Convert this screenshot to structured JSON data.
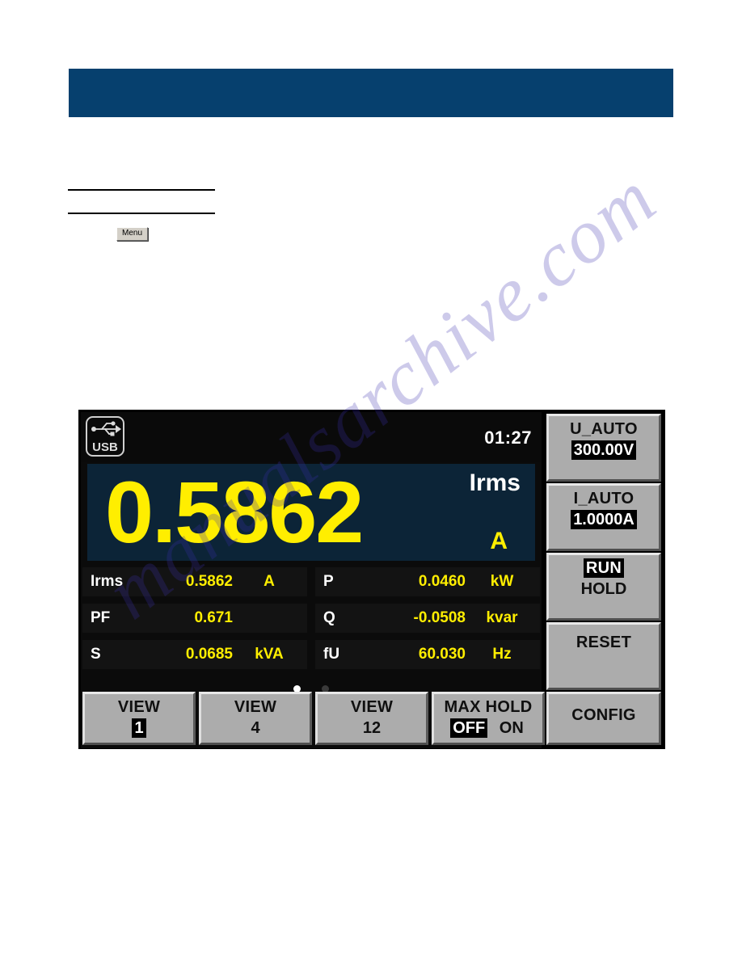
{
  "watermark": {
    "text": "manualsarchive.com"
  },
  "document": {
    "menu_button_label": "Menu"
  },
  "device": {
    "status_bar": {
      "usb_icon_label": "USB",
      "clock": "01:27"
    },
    "primary_reading": {
      "value": "0.5862",
      "quantity": "Irms",
      "unit": "A"
    },
    "measurements": {
      "left": [
        {
          "label": "Irms",
          "value": "0.5862",
          "unit": "A"
        },
        {
          "label": "PF",
          "value": "0.671",
          "unit": ""
        },
        {
          "label": "S",
          "value": "0.0685",
          "unit": "kVA"
        }
      ],
      "right": [
        {
          "label": "P",
          "value": "0.0460",
          "unit": "kW"
        },
        {
          "label": "Q",
          "value": "-0.0508",
          "unit": "kvar"
        },
        {
          "label": "fU",
          "value": "60.030",
          "unit": "Hz"
        }
      ]
    },
    "page_indicator": {
      "pages": 2,
      "active": 1
    },
    "side_keys": {
      "u_auto": {
        "title": "U_AUTO",
        "value": "300.00V"
      },
      "i_auto": {
        "title": "I_AUTO",
        "value": "1.0000A"
      },
      "run_hold": {
        "run": "RUN",
        "hold": "HOLD",
        "selected": "RUN"
      },
      "reset": {
        "title": "RESET"
      },
      "config": {
        "title": "CONFIG"
      }
    },
    "bottom_keys": {
      "view1": {
        "title": "VIEW",
        "value": "1"
      },
      "view4": {
        "title": "VIEW",
        "value": "4"
      },
      "view12": {
        "title": "VIEW",
        "value": "12"
      },
      "max_hold": {
        "title": "MAX HOLD",
        "off": "OFF",
        "on": "ON",
        "selected": "OFF"
      }
    }
  },
  "colors": {
    "banner": "#06406e",
    "value_yellow": "#ffee00",
    "panel_navy": "#0c2437",
    "key_face": "#acacac"
  }
}
